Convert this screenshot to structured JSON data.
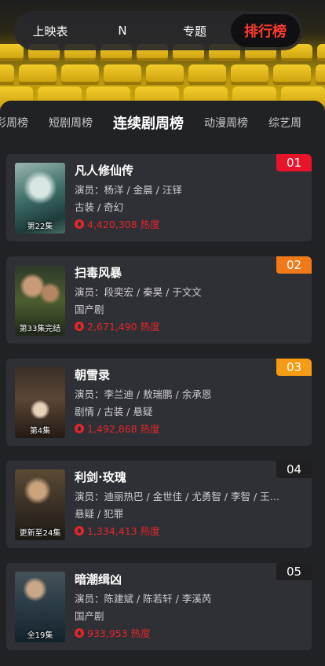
{
  "topnav": {
    "tabs": [
      "上映表",
      "N",
      "专题"
    ],
    "active_tab": "排行榜"
  },
  "subtabs": [
    "彩周榜",
    "短剧周榜",
    "连续剧周榜",
    "动漫周榜",
    "综艺周"
  ],
  "active_subtab_index": 2,
  "colors": {
    "rank_1": "#e8152a",
    "rank_2": "#f07a1a",
    "rank_3": "#f59b14",
    "rank_other": "#1f1f22",
    "heat": "#e3262a",
    "active_tab": "#ff3a2f"
  },
  "items": [
    {
      "rank": "01",
      "title": "凡人修仙传",
      "cast": "演员：杨洋 / 金晨 / 汪铎",
      "genre": "古装 / 奇幻",
      "heat": "4,420,308 热度",
      "poster_caption": "第22集"
    },
    {
      "rank": "02",
      "title": "扫毒风暴",
      "cast": "演员：段奕宏 / 秦昊 / 于文文",
      "genre": "国产剧",
      "heat": "2,671,490 热度",
      "poster_caption": "第33集完结"
    },
    {
      "rank": "03",
      "title": "朝雪录",
      "cast": "演员：李兰迪 / 敖瑞鹏 / 余承恩",
      "genre": "剧情 / 古装 / 悬疑",
      "heat": "1,492,868 热度",
      "poster_caption": "第4集"
    },
    {
      "rank": "04",
      "title": "利剑·玫瑰",
      "cast": "演员：迪丽热巴 / 金世佳 / 尤勇智 / 李智 / 王…",
      "genre": "悬疑 / 犯罪",
      "heat": "1,334,413 热度",
      "poster_caption": "更新至24集"
    },
    {
      "rank": "05",
      "title": "暗潮缉凶",
      "cast": "演员：陈建斌 / 陈若轩 / 李溪芮",
      "genre": "国产剧",
      "heat": "933,953 热度",
      "poster_caption": "全19集"
    }
  ]
}
